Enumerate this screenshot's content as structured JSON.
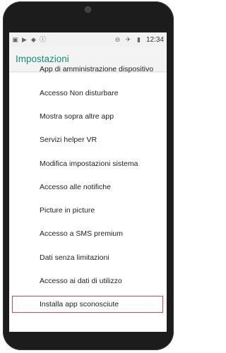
{
  "status_bar": {
    "left_icons": [
      "sim-icon",
      "play-store-icon",
      "android-icon",
      "info-icon"
    ],
    "right_icons": [
      "do-not-disturb-icon",
      "airplane-icon",
      "battery-icon"
    ],
    "time": "12:34"
  },
  "app_bar": {
    "title": "Impostazioni"
  },
  "settings_list": {
    "items": [
      {
        "label": "App di amministrazione dispositivo",
        "partially_visible": true
      },
      {
        "label": "Accesso Non disturbare"
      },
      {
        "label": "Mostra sopra altre app"
      },
      {
        "label": "Servizi helper VR"
      },
      {
        "label": "Modifica impostazioni sistema"
      },
      {
        "label": "Accesso alle notifiche"
      },
      {
        "label": "Picture in picture"
      },
      {
        "label": "Accesso a SMS premium"
      },
      {
        "label": "Dati senza limitazioni"
      },
      {
        "label": "Accesso ai dati di utilizzo"
      },
      {
        "label": "Installa app sconosciute",
        "highlighted": true
      }
    ]
  },
  "colors": {
    "accent": "#168c7c",
    "highlight_border": "#d14b55",
    "appbar_bg": "#f3f3f3",
    "statusbar_bg": "#f1f1f1"
  }
}
